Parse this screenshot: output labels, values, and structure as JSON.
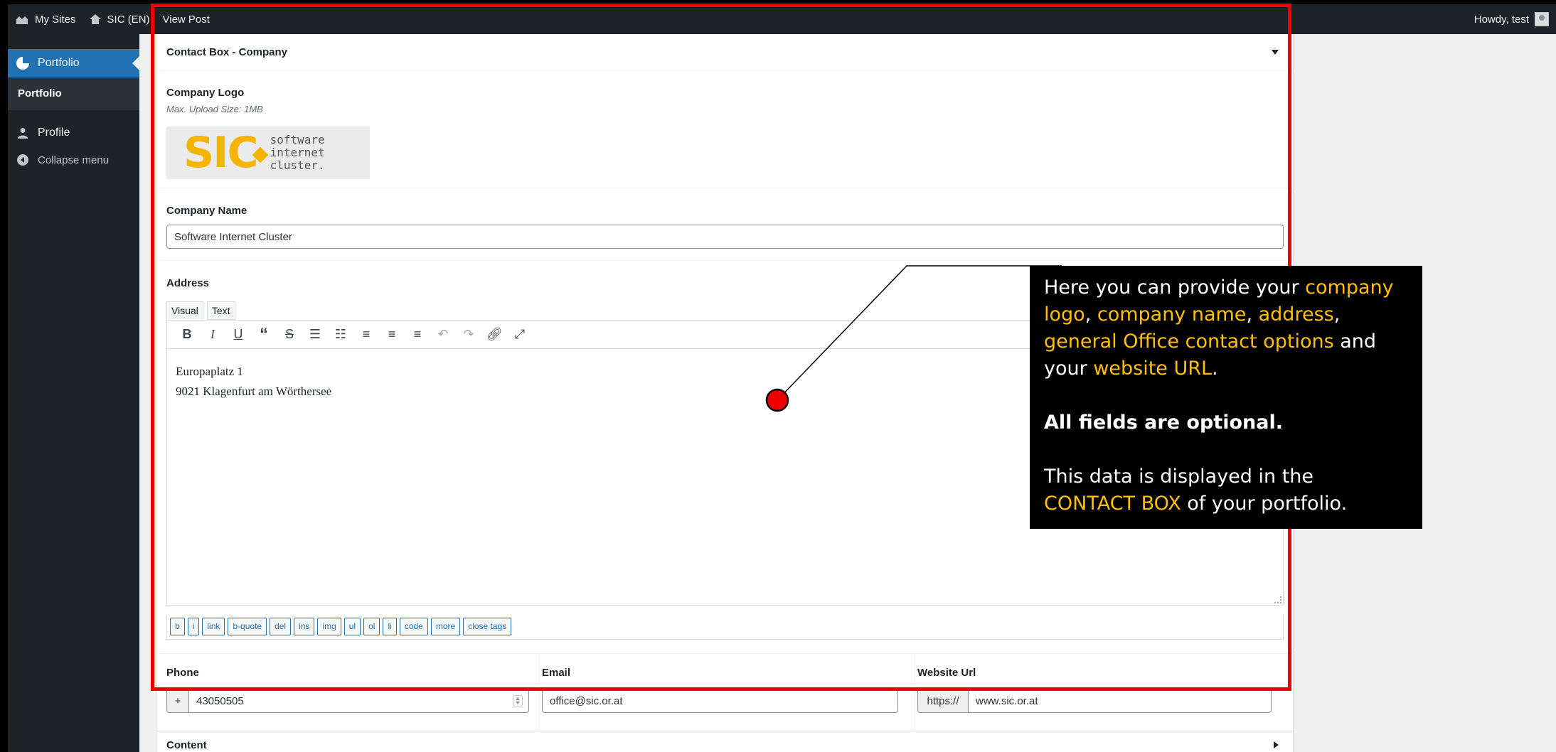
{
  "adminbar": {
    "my_sites": "My Sites",
    "site_name": "SIC (EN)",
    "view_post": "View Post",
    "howdy": "Howdy, test"
  },
  "sidebar": {
    "portfolio_top": "Portfolio",
    "portfolio_sub": "Portfolio",
    "profile": "Profile",
    "collapse": "Collapse menu"
  },
  "contact_box": {
    "title": "Contact Box - Company",
    "company_logo_label": "Company Logo",
    "company_logo_desc": "Max. Upload Size: 1MB",
    "logo_mark": "SIC",
    "logo_lines": [
      "software",
      "internet",
      "cluster."
    ],
    "company_name_label": "Company Name",
    "company_name_value": "Software Internet Cluster",
    "address_label": "Address",
    "tab_visual": "Visual",
    "tab_text": "Text",
    "address_lines": [
      "Europaplatz 1",
      "9021 Klagenfurt am Wörthersee"
    ],
    "toolbar_icons": [
      "bold-icon",
      "italic-icon",
      "underline-icon",
      "blockquote-icon",
      "strikethrough-icon",
      "bullet-list-icon",
      "numbered-list-icon",
      "align-left-icon",
      "align-center-icon",
      "align-right-icon",
      "undo-icon",
      "redo-icon",
      "link-icon",
      "fullscreen-icon"
    ],
    "quicktags": [
      "b",
      "i",
      "link",
      "b-quote",
      "del",
      "ins",
      "img",
      "ul",
      "ol",
      "li",
      "code",
      "more",
      "close tags"
    ],
    "phone_label": "Phone",
    "phone_prefix": "+",
    "phone_value": "43050505",
    "email_label": "Email",
    "email_value": "office@sic.or.at",
    "website_label": "Website Url",
    "website_prefix": "https://",
    "website_value": "www.sic.or.at"
  },
  "content_box": {
    "title": "Content"
  },
  "callout": {
    "p1_a": "Here you can provide your ",
    "p1_company_logo": "company logo",
    "p1_b": ", ",
    "p1_company_name": "company name",
    "p1_c": ", ",
    "p1_address": "address",
    "p1_d": ", ",
    "p1_general": "general Office contact options",
    "p1_e": " and your ",
    "p1_website": "website URL",
    "p1_f": ".",
    "p2": "All fields are optional.",
    "p3_a": "This data is displayed in the ",
    "p3_contact": "CONTACT BOX",
    "p3_b": " of your portfolio."
  },
  "colors": {
    "highlight_border": "#ee0000",
    "callout_accent": "#ffc000",
    "wp_blue": "#2271b1",
    "logo_yellow": "#f5b400"
  }
}
